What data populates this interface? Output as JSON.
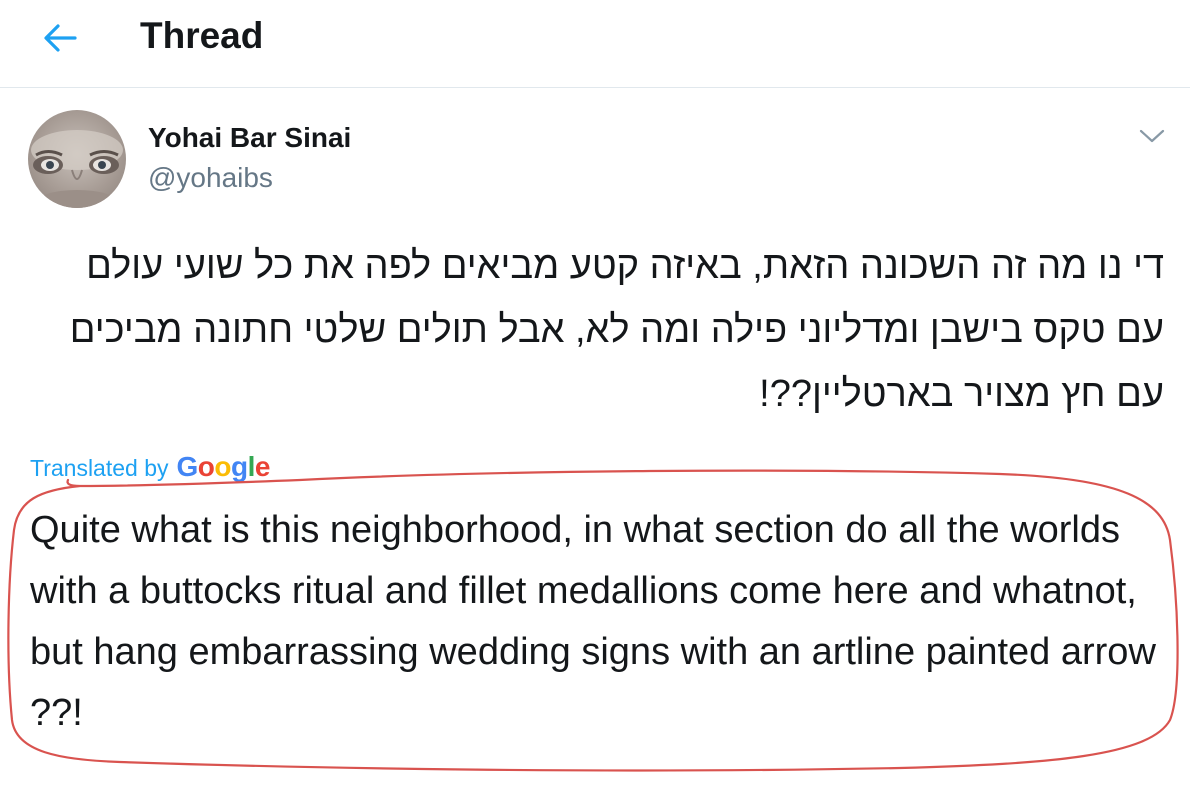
{
  "header": {
    "title": "Thread"
  },
  "tweet": {
    "display_name": "Yohai Bar Sinai",
    "handle": "@yohaibs",
    "hebrew_text": "די נו מה זה השכונה הזאת, באיזה קטע מביאים לפה את כל שועי עולם עם טקס בישבן ומדליוני פילה ומה לא, אבל תולים שלטי חתונה מביכים עם חץ מצויר בארטליין??!",
    "translated_by_label": "Translated by",
    "translator_logo": {
      "letters": [
        "G",
        "o",
        "o",
        "g",
        "l",
        "e"
      ],
      "colors": [
        "#4285f4",
        "#ea4335",
        "#fbbc05",
        "#4285f4",
        "#34a853",
        "#ea4335"
      ]
    },
    "translation_text": "Quite what is this neighborhood, in what section do all the worlds with a buttocks ritual and fillet medallions come here and whatnot, but hang embarrassing wedding signs with an artline painted arrow ??!"
  },
  "icons": {
    "back": "back-arrow-icon",
    "menu": "chevron-down-icon"
  },
  "colors": {
    "accent": "#1da1f2",
    "text": "#14171a",
    "secondary_text": "#657786",
    "divider": "#e1e8ed",
    "annotation": "#d9534f"
  }
}
